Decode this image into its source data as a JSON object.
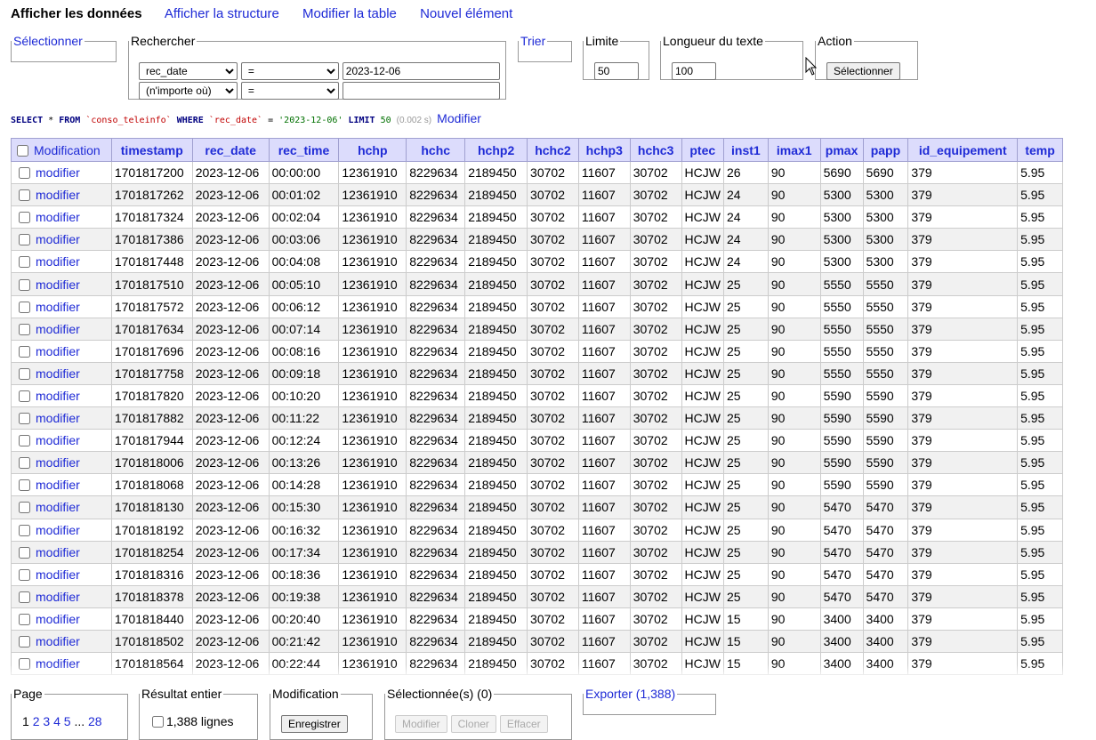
{
  "nav": {
    "active": "Afficher les données",
    "tabs": [
      "Afficher la structure",
      "Modifier la table",
      "Nouvel élément"
    ]
  },
  "filters": {
    "select_legend": "Sélectionner",
    "search_legend": "Rechercher",
    "row1": {
      "column": "rec_date",
      "operator": "=",
      "value": "2023-12-06"
    },
    "row2": {
      "column": "(n'importe où)",
      "operator": "=",
      "value": ""
    },
    "sort_legend": "Trier",
    "limit_legend": "Limite",
    "limit_value": "50",
    "textlen_legend": "Longueur du texte",
    "textlen_value": "100",
    "action_legend": "Action",
    "action_button": "Sélectionner"
  },
  "sql": {
    "select": "SELECT",
    "star": "*",
    "from": "FROM",
    "table": "`conso_teleinfo`",
    "where": "WHERE",
    "column": "`rec_date`",
    "op": "=",
    "value": "'2023-12-06'",
    "limit": "LIMIT",
    "limit_n": "50",
    "time": "(0.002 s)",
    "edit": "Modifier"
  },
  "table": {
    "mod_header": "Modification",
    "columns": [
      "timestamp",
      "rec_date",
      "rec_time",
      "hchp",
      "hchc",
      "hchp2",
      "hchc2",
      "hchp3",
      "hchc3",
      "ptec",
      "inst1",
      "imax1",
      "pmax",
      "papp",
      "id_equipement",
      "temp"
    ],
    "edit_label": "modifier",
    "rows": [
      [
        "1701817200",
        "2023-12-06",
        "00:00:00",
        "12361910",
        "8229634",
        "2189450",
        "30702",
        "11607",
        "30702",
        "HCJW",
        "26",
        "90",
        "5690",
        "5690",
        "379",
        "5.95"
      ],
      [
        "1701817262",
        "2023-12-06",
        "00:01:02",
        "12361910",
        "8229634",
        "2189450",
        "30702",
        "11607",
        "30702",
        "HCJW",
        "24",
        "90",
        "5300",
        "5300",
        "379",
        "5.95"
      ],
      [
        "1701817324",
        "2023-12-06",
        "00:02:04",
        "12361910",
        "8229634",
        "2189450",
        "30702",
        "11607",
        "30702",
        "HCJW",
        "24",
        "90",
        "5300",
        "5300",
        "379",
        "5.95"
      ],
      [
        "1701817386",
        "2023-12-06",
        "00:03:06",
        "12361910",
        "8229634",
        "2189450",
        "30702",
        "11607",
        "30702",
        "HCJW",
        "24",
        "90",
        "5300",
        "5300",
        "379",
        "5.95"
      ],
      [
        "1701817448",
        "2023-12-06",
        "00:04:08",
        "12361910",
        "8229634",
        "2189450",
        "30702",
        "11607",
        "30702",
        "HCJW",
        "24",
        "90",
        "5300",
        "5300",
        "379",
        "5.95"
      ],
      [
        "1701817510",
        "2023-12-06",
        "00:05:10",
        "12361910",
        "8229634",
        "2189450",
        "30702",
        "11607",
        "30702",
        "HCJW",
        "25",
        "90",
        "5550",
        "5550",
        "379",
        "5.95"
      ],
      [
        "1701817572",
        "2023-12-06",
        "00:06:12",
        "12361910",
        "8229634",
        "2189450",
        "30702",
        "11607",
        "30702",
        "HCJW",
        "25",
        "90",
        "5550",
        "5550",
        "379",
        "5.95"
      ],
      [
        "1701817634",
        "2023-12-06",
        "00:07:14",
        "12361910",
        "8229634",
        "2189450",
        "30702",
        "11607",
        "30702",
        "HCJW",
        "25",
        "90",
        "5550",
        "5550",
        "379",
        "5.95"
      ],
      [
        "1701817696",
        "2023-12-06",
        "00:08:16",
        "12361910",
        "8229634",
        "2189450",
        "30702",
        "11607",
        "30702",
        "HCJW",
        "25",
        "90",
        "5550",
        "5550",
        "379",
        "5.95"
      ],
      [
        "1701817758",
        "2023-12-06",
        "00:09:18",
        "12361910",
        "8229634",
        "2189450",
        "30702",
        "11607",
        "30702",
        "HCJW",
        "25",
        "90",
        "5550",
        "5550",
        "379",
        "5.95"
      ],
      [
        "1701817820",
        "2023-12-06",
        "00:10:20",
        "12361910",
        "8229634",
        "2189450",
        "30702",
        "11607",
        "30702",
        "HCJW",
        "25",
        "90",
        "5590",
        "5590",
        "379",
        "5.95"
      ],
      [
        "1701817882",
        "2023-12-06",
        "00:11:22",
        "12361910",
        "8229634",
        "2189450",
        "30702",
        "11607",
        "30702",
        "HCJW",
        "25",
        "90",
        "5590",
        "5590",
        "379",
        "5.95"
      ],
      [
        "1701817944",
        "2023-12-06",
        "00:12:24",
        "12361910",
        "8229634",
        "2189450",
        "30702",
        "11607",
        "30702",
        "HCJW",
        "25",
        "90",
        "5590",
        "5590",
        "379",
        "5.95"
      ],
      [
        "1701818006",
        "2023-12-06",
        "00:13:26",
        "12361910",
        "8229634",
        "2189450",
        "30702",
        "11607",
        "30702",
        "HCJW",
        "25",
        "90",
        "5590",
        "5590",
        "379",
        "5.95"
      ],
      [
        "1701818068",
        "2023-12-06",
        "00:14:28",
        "12361910",
        "8229634",
        "2189450",
        "30702",
        "11607",
        "30702",
        "HCJW",
        "25",
        "90",
        "5590",
        "5590",
        "379",
        "5.95"
      ],
      [
        "1701818130",
        "2023-12-06",
        "00:15:30",
        "12361910",
        "8229634",
        "2189450",
        "30702",
        "11607",
        "30702",
        "HCJW",
        "25",
        "90",
        "5470",
        "5470",
        "379",
        "5.95"
      ],
      [
        "1701818192",
        "2023-12-06",
        "00:16:32",
        "12361910",
        "8229634",
        "2189450",
        "30702",
        "11607",
        "30702",
        "HCJW",
        "25",
        "90",
        "5470",
        "5470",
        "379",
        "5.95"
      ],
      [
        "1701818254",
        "2023-12-06",
        "00:17:34",
        "12361910",
        "8229634",
        "2189450",
        "30702",
        "11607",
        "30702",
        "HCJW",
        "25",
        "90",
        "5470",
        "5470",
        "379",
        "5.95"
      ],
      [
        "1701818316",
        "2023-12-06",
        "00:18:36",
        "12361910",
        "8229634",
        "2189450",
        "30702",
        "11607",
        "30702",
        "HCJW",
        "25",
        "90",
        "5470",
        "5470",
        "379",
        "5.95"
      ],
      [
        "1701818378",
        "2023-12-06",
        "00:19:38",
        "12361910",
        "8229634",
        "2189450",
        "30702",
        "11607",
        "30702",
        "HCJW",
        "25",
        "90",
        "5470",
        "5470",
        "379",
        "5.95"
      ],
      [
        "1701818440",
        "2023-12-06",
        "00:20:40",
        "12361910",
        "8229634",
        "2189450",
        "30702",
        "11607",
        "30702",
        "HCJW",
        "15",
        "90",
        "3400",
        "3400",
        "379",
        "5.95"
      ],
      [
        "1701818502",
        "2023-12-06",
        "00:21:42",
        "12361910",
        "8229634",
        "2189450",
        "30702",
        "11607",
        "30702",
        "HCJW",
        "15",
        "90",
        "3400",
        "3400",
        "379",
        "5.95"
      ],
      [
        "1701818564",
        "2023-12-06",
        "00:22:44",
        "12361910",
        "8229634",
        "2189450",
        "30702",
        "11607",
        "30702",
        "HCJW",
        "15",
        "90",
        "3400",
        "3400",
        "379",
        "5.95"
      ]
    ]
  },
  "footer": {
    "page_legend": "Page",
    "pages": [
      "1",
      "2",
      "3",
      "4",
      "5"
    ],
    "ellipsis": "...",
    "last_page": "28",
    "result_legend": "Résultat entier",
    "result_label": "1,388 lignes",
    "mod_legend": "Modification",
    "save_button": "Enregistrer",
    "selected_legend": "Sélectionnée(s) (0)",
    "btn_edit": "Modifier",
    "btn_clone": "Cloner",
    "btn_delete": "Effacer",
    "export_legend": "Exporter (1,388)"
  },
  "colors": {
    "link": "#1f2bd6",
    "header_bg": "#dcdcfc",
    "row_alt": "#f1f1f1"
  }
}
